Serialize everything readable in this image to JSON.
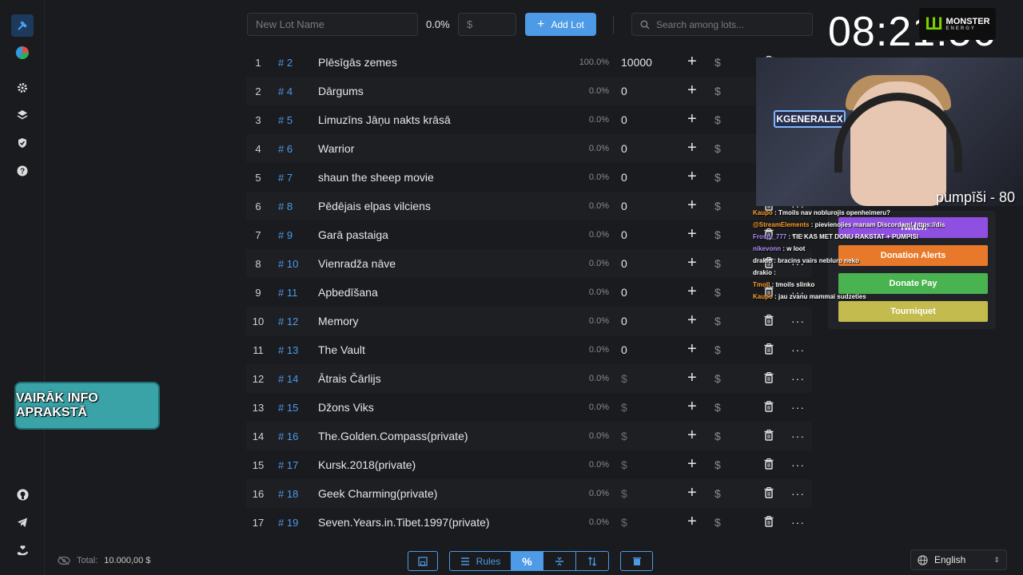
{
  "nav": {
    "items": [
      "logo-icon",
      "pie-chart-icon",
      "gear-icon",
      "layers-icon",
      "shield-icon",
      "help-icon",
      "github-icon",
      "telegram-icon",
      "donate-hand-icon"
    ]
  },
  "promo": {
    "text": "VAIRĀK INFO APRAKSTĀ"
  },
  "footer": {
    "total_label": "Total:",
    "total_value": "10.000,00 $"
  },
  "topbar": {
    "lot_name_placeholder": "New Lot Name",
    "percent": "0.0%",
    "amount_placeholder": "$",
    "add_lot_label": "Add Lot",
    "search_placeholder": "Search among lots..."
  },
  "clock": "08:21:56",
  "sponsor": {
    "brand": "MONSTER",
    "sub": "ENERGY"
  },
  "lots": [
    {
      "num": "1",
      "id": "# 2",
      "name": "Plēsīgās zemes",
      "pct": "100.0%",
      "amount": "10000"
    },
    {
      "num": "2",
      "id": "# 4",
      "name": "Dārgums",
      "pct": "0.0%",
      "amount": "0"
    },
    {
      "num": "3",
      "id": "# 5",
      "name": "Limuzīns Jāņu nakts krāsā",
      "pct": "0.0%",
      "amount": "0"
    },
    {
      "num": "4",
      "id": "# 6",
      "name": "Warrior",
      "pct": "0.0%",
      "amount": "0"
    },
    {
      "num": "5",
      "id": "# 7",
      "name": "shaun the sheep movie",
      "pct": "0.0%",
      "amount": "0"
    },
    {
      "num": "6",
      "id": "# 8",
      "name": "Pēdējais elpas vilciens",
      "pct": "0.0%",
      "amount": "0"
    },
    {
      "num": "7",
      "id": "# 9",
      "name": "Garā pastaiga",
      "pct": "0.0%",
      "amount": "0"
    },
    {
      "num": "8",
      "id": "# 10",
      "name": "Vienradža nāve",
      "pct": "0.0%",
      "amount": "0"
    },
    {
      "num": "9",
      "id": "# 11",
      "name": "Apbedīšana",
      "pct": "0.0%",
      "amount": "0"
    },
    {
      "num": "10",
      "id": "# 12",
      "name": "Memory",
      "pct": "0.0%",
      "amount": "0"
    },
    {
      "num": "11",
      "id": "# 13",
      "name": "The Vault",
      "pct": "0.0%",
      "amount": "0"
    },
    {
      "num": "12",
      "id": "# 14",
      "name": "Ātrais Čārlijs",
      "pct": "0.0%",
      "amount": "$"
    },
    {
      "num": "13",
      "id": "# 15",
      "name": "Džons Viks",
      "pct": "0.0%",
      "amount": "$"
    },
    {
      "num": "14",
      "id": "# 16",
      "name": "The.Golden.Compass(private)",
      "pct": "0.0%",
      "amount": "$"
    },
    {
      "num": "15",
      "id": "# 17",
      "name": "Kursk.2018(private)",
      "pct": "0.0%",
      "amount": "$"
    },
    {
      "num": "16",
      "id": "# 18",
      "name": "Geek Charming(private)",
      "pct": "0.0%",
      "amount": "$"
    },
    {
      "num": "17",
      "id": "# 19",
      "name": "Seven.Years.in.Tibet.1997(private)",
      "pct": "0.0%",
      "amount": "$"
    }
  ],
  "row_actions": {
    "plus": "+",
    "dollar": "$",
    "more": "···"
  },
  "webcam": {
    "sign_text": "KGENERALEX",
    "label": "pumpīši - 80"
  },
  "chat": [
    {
      "user": "Kaupo",
      "user_color": "#ff9d2e",
      "text": ": Tmoils nav noblurojis openheimeru?"
    },
    {
      "user": "@StreamElements",
      "user_color": "#ff9d2e",
      "text": ": pievienojies manam Discordam! https://discord.gg/sJRQXeV"
    },
    {
      "user": "Frosty_777",
      "user_color": "#b08cff",
      "text": ": TIE KAS MET DONU RAKSTAT + PUMPISI"
    },
    {
      "user": "nikevonn",
      "user_color": "#b08cff",
      "text": ": w loot"
    },
    {
      "user": "drakio",
      "user_color": "#ffffff",
      "text": ": bracins vairs nebluro neko"
    },
    {
      "user": "drakio",
      "user_color": "#ffffff",
      "text": ":"
    },
    {
      "user": "Tmoll",
      "user_color": "#ff9d2e",
      "text": ": tmoils slinko"
    },
    {
      "user": "Kaupo",
      "user_color": "#ff9d2e",
      "text": ": jau zvanu mammai sudzeties"
    }
  ],
  "donations": [
    {
      "label": "Twitch",
      "color": "#8f4fe0"
    },
    {
      "label": "Donation Alerts",
      "color": "#e9792a"
    },
    {
      "label": "Donate Pay",
      "color": "#49b34f"
    },
    {
      "label": "Tourniquet",
      "color": "#c4bb4e"
    }
  ],
  "toolbar": {
    "rules_label": "Rules",
    "percent_label": "%"
  },
  "language": {
    "selected": "English"
  }
}
